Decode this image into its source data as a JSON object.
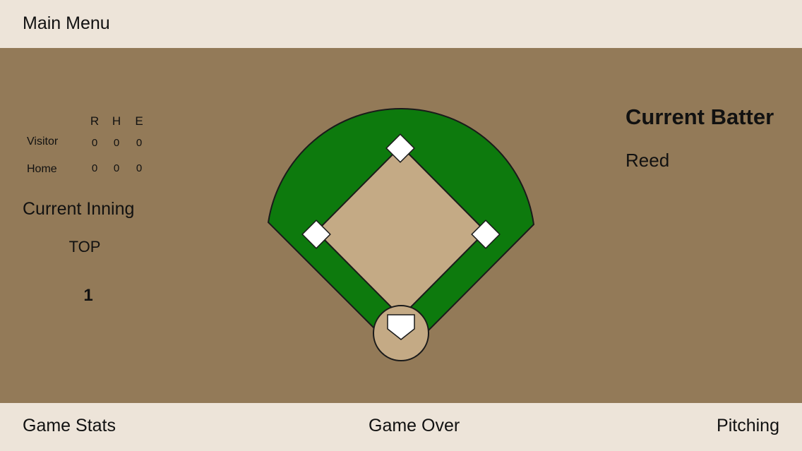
{
  "topbar": {
    "main_menu_label": "Main Menu"
  },
  "scoreboard": {
    "headers": [
      "R",
      "H",
      "E"
    ],
    "rows": [
      {
        "team": "Visitor",
        "values": [
          "0",
          "0",
          "0"
        ]
      },
      {
        "team": "Home",
        "values": [
          "0",
          "0",
          "0"
        ]
      }
    ]
  },
  "inning": {
    "title": "Current Inning",
    "half": "TOP",
    "number": "1"
  },
  "batter": {
    "title": "Current Batter",
    "name": "Reed"
  },
  "bottombar": {
    "game_stats_label": "Game Stats",
    "game_over_label": "Game Over",
    "pitching_label": "Pitching"
  },
  "colors": {
    "header_bg": "#ede4d9",
    "field_bg": "#937a58",
    "grass": "#0d7a0d",
    "infield_dirt": "#c4aa85",
    "base": "#ffffff"
  }
}
